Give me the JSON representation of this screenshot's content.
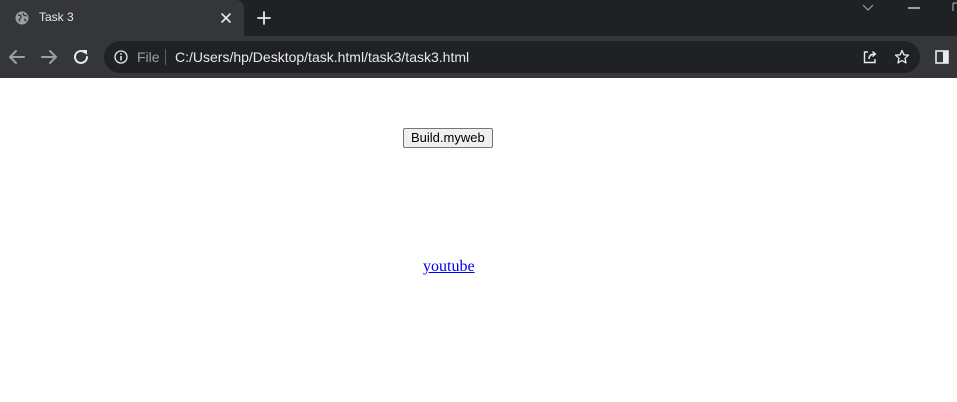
{
  "tab": {
    "title": "Task 3",
    "favicon": "globe-icon",
    "close_icon": "close-icon"
  },
  "tabstrip": {
    "new_tab_icon": "plus-icon",
    "tab_search_icon": "chevron-down-icon",
    "minimize_icon": "minimize-icon",
    "maximize_icon": "maximize-icon"
  },
  "toolbar": {
    "back_icon": "arrow-left-icon",
    "forward_icon": "arrow-right-icon",
    "reload_icon": "reload-icon",
    "site_info_icon": "info-icon",
    "scheme_label": "File",
    "url": "C:/Users/hp/Desktop/task.html/task3/task3.html",
    "share_icon": "share-icon",
    "bookmark_icon": "star-icon",
    "side_panel_icon": "side-panel-icon"
  },
  "page": {
    "button_label": "Build.myweb",
    "link_text": "youtube"
  },
  "colors": {
    "tabstrip_bg": "#202124",
    "tab_active_bg": "#35363a",
    "toolbar_bg": "#35363a",
    "omnibox_bg": "#202124",
    "text_light": "#e8eaed",
    "text_muted": "#9aa0a6",
    "link": "#0000ee"
  }
}
